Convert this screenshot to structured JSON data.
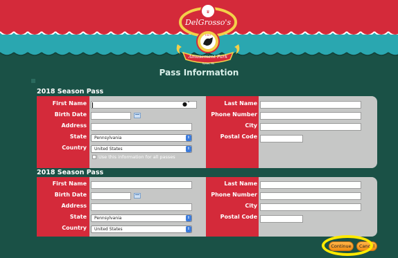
{
  "brand": {
    "name": "DelGrosso's",
    "tagline": "Amusement Park",
    "location": "Tipton, PA",
    "year": "1907"
  },
  "colors": {
    "red": "#d42a3a",
    "teal": "#2aa7b0",
    "green": "#1a5146",
    "panel": "#c6c7c6",
    "button": "#f5a22e",
    "highlight": "#ffea00"
  },
  "page": {
    "title": "Pass Information"
  },
  "passes": [
    {
      "title": "2018 Season Pass",
      "labels": {
        "first_name": "First Name",
        "birth_date": "Birth Date",
        "address": "Address",
        "state": "State",
        "country": "Country",
        "last_name": "Last Name",
        "phone": "Phone Number",
        "city": "City",
        "postal": "Postal Code"
      },
      "state_value": "Pennsylvania",
      "country_value": "United States",
      "checkbox_label": "Use this information for all passes"
    },
    {
      "title": "2018 Season Pass",
      "labels": {
        "first_name": "First Name",
        "birth_date": "Birth Date",
        "address": "Address",
        "state": "State",
        "country": "Country",
        "last_name": "Last Name",
        "phone": "Phone Number",
        "city": "City",
        "postal": "Postal Code"
      },
      "state_value": "Pennsylvania",
      "country_value": "United States"
    }
  ],
  "buttons": {
    "continue": "Continue",
    "cancel": "Cancel"
  }
}
